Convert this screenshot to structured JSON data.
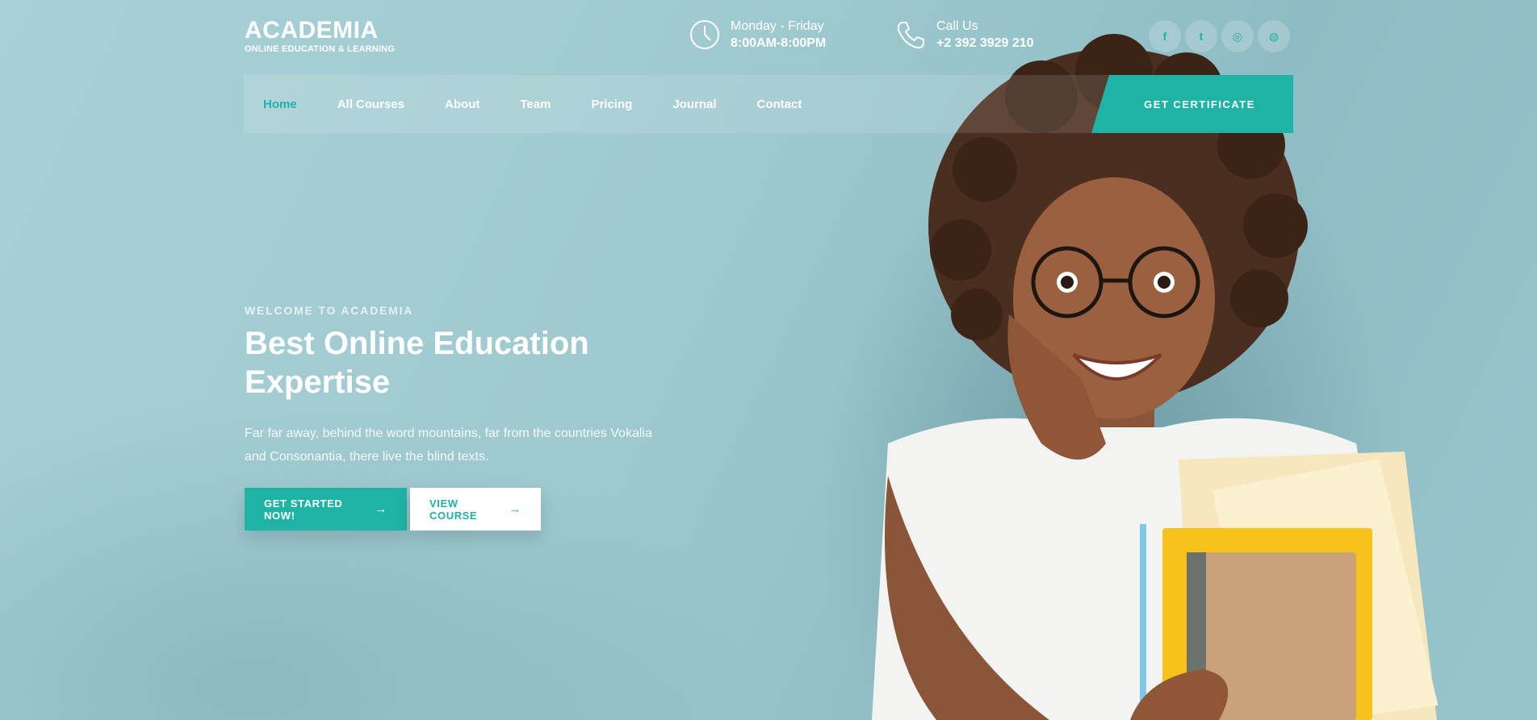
{
  "brand": {
    "name": "ACADEMIA",
    "tagline": "ONLINE EDUCATION & LEARNING"
  },
  "topbar": {
    "hours": {
      "icon": "clock-icon",
      "line1": "Monday - Friday",
      "line2": "8:00AM-8:00PM"
    },
    "call": {
      "icon": "phone-icon",
      "line1": "Call Us",
      "line2": "+2 392 3929 210"
    },
    "social": [
      {
        "name": "facebook-icon",
        "glyph": "f"
      },
      {
        "name": "twitter-icon",
        "glyph": "t"
      },
      {
        "name": "instagram-icon",
        "glyph": "◎"
      },
      {
        "name": "dribbble-icon",
        "glyph": "◍"
      }
    ]
  },
  "nav": {
    "items": [
      "Home",
      "All Courses",
      "About",
      "Team",
      "Pricing",
      "Journal",
      "Contact"
    ],
    "active": "Home",
    "cta": "GET CERTIFICATE"
  },
  "hero": {
    "eyebrow": "WELCOME TO ACADEMIA",
    "headline": "Best Online Education Expertise",
    "lede": "Far far away, behind the word mountains, far from the countries Vokalia and Consonantia, there live the blind texts.",
    "primary_cta": "GET STARTED NOW!",
    "secondary_cta": "VIEW COURSE",
    "arrow": "→"
  },
  "colors": {
    "accent": "#1fb3a5",
    "background": "#a4ced4",
    "text": "#ffffff"
  }
}
